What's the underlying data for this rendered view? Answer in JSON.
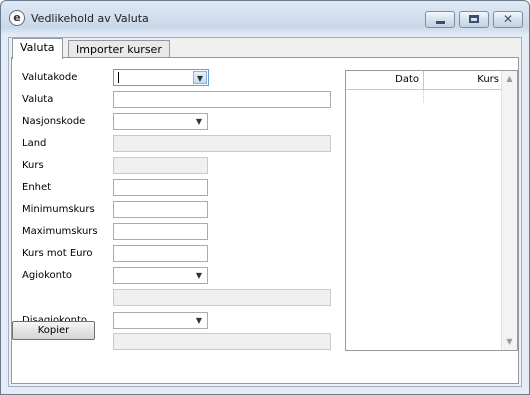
{
  "window": {
    "title": "Vedlikehold av Valuta",
    "app_icon": "e",
    "minimize_icon": "minimize-icon",
    "maximize_icon": "maximize-icon",
    "close_icon": "close-icon",
    "close_glyph": "✕"
  },
  "tabs": [
    {
      "label": "Valuta",
      "active": true
    },
    {
      "label": "Importer kurser",
      "active": false
    }
  ],
  "form": {
    "valutakode": {
      "label": "Valutakode",
      "value": ""
    },
    "valuta": {
      "label": "Valuta",
      "value": ""
    },
    "nasjonskode": {
      "label": "Nasjonskode",
      "value": ""
    },
    "land": {
      "label": "Land",
      "value": ""
    },
    "kurs": {
      "label": "Kurs",
      "value": ""
    },
    "enhet": {
      "label": "Enhet",
      "value": ""
    },
    "minimumskurs": {
      "label": "Minimumskurs",
      "value": ""
    },
    "maximumskurs": {
      "label": "Maximumskurs",
      "value": ""
    },
    "kurs_mot_euro": {
      "label": "Kurs mot Euro",
      "value": ""
    },
    "agiokonto": {
      "label": "Agiokonto",
      "value": "",
      "description": ""
    },
    "disagiokonto": {
      "label": "Disagiokonto",
      "value": "",
      "description": ""
    }
  },
  "grid": {
    "columns": [
      "Dato",
      "Kurs"
    ],
    "rows": []
  },
  "buttons": {
    "kopier": "Kopier"
  },
  "colors": {
    "accent": "#6a9cd6",
    "frame": "#c9d8ea"
  }
}
